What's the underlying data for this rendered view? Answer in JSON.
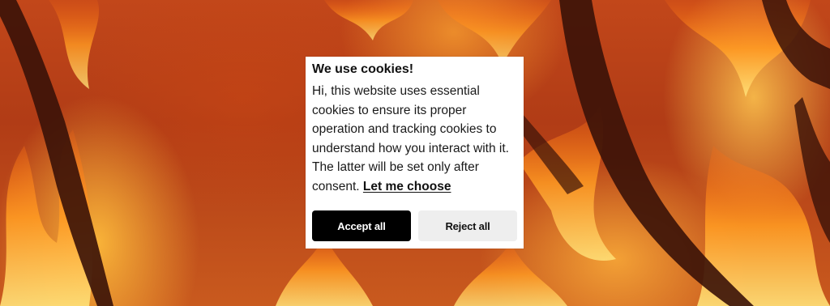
{
  "background": {
    "description_icon": "wildfire-background-image",
    "colors": {
      "flame_light": "#ffd36b",
      "flame_mid": "#ff8a1e",
      "flame_deep": "#c2471a",
      "trunk": "#3a1208"
    }
  },
  "cookie_banner": {
    "title": "We use cookies!",
    "body": "Hi, this website uses essential cookies to ensure its proper operation and tracking cookies to understand how you interact with it. The latter will be set only after consent.",
    "link_label": "Let me choose",
    "accept_label": "Accept all",
    "reject_label": "Reject all",
    "colors": {
      "accept_bg": "#000000",
      "accept_text": "#ffffff",
      "reject_bg": "#eeeeee",
      "reject_text": "#111111"
    }
  }
}
